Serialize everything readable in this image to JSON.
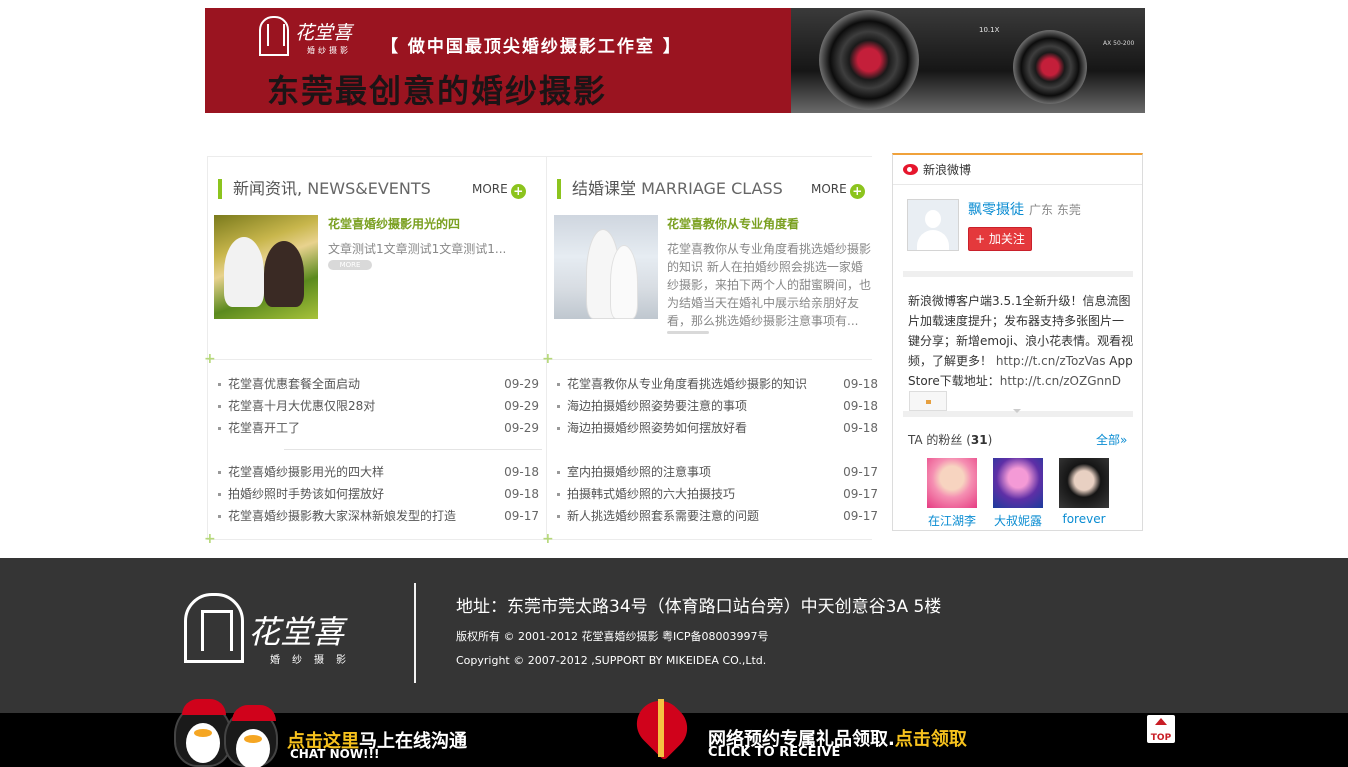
{
  "banner": {
    "logo_text": "花堂喜",
    "logo_sub": "婚纱摄影",
    "slogan": "【 做中国最顶尖婚纱摄影工作室 】",
    "headline": "东莞最创意的婚纱摄影",
    "camera_label": "10.1X",
    "camera_label2": "AX 50-200"
  },
  "news": {
    "title_cn": "新闻资讯",
    "title_en": "NEWS&EVENTS",
    "more": "MORE",
    "featured_title": "花堂喜婚纱摄影用光的四",
    "featured_desc": "文章测试1文章测试1文章测试1...",
    "featured_more": "MORE",
    "items_a": [
      {
        "title": "花堂喜优惠套餐全面启动",
        "date": "09-29"
      },
      {
        "title": "花堂喜十月大优惠仅限28对",
        "date": "09-29"
      },
      {
        "title": "花堂喜开工了",
        "date": "09-29"
      }
    ],
    "items_b": [
      {
        "title": "花堂喜婚纱摄影用光的四大样",
        "date": "09-18"
      },
      {
        "title": "拍婚纱照时手势该如何摆放好",
        "date": "09-18"
      },
      {
        "title": "花堂喜婚纱摄影教大家深林新娘发型的打造",
        "date": "09-17"
      }
    ]
  },
  "classes": {
    "title_cn": "结婚课堂",
    "title_en": "MARRIAGE CLASS",
    "more": "MORE",
    "featured_title": "花堂喜教你从专业角度看",
    "featured_desc": "花堂喜教你从专业角度看挑选婚纱摄影的知识 新人在拍婚纱照会挑选一家婚纱摄影，来拍下两个人的甜蜜瞬间，也为结婚当天在婚礼中展示给亲朋好友看，那么挑选婚纱摄影注意事项有...",
    "items_a": [
      {
        "title": "花堂喜教你从专业角度看挑选婚纱摄影的知识",
        "date": "09-18"
      },
      {
        "title": "海边拍摄婚纱照姿势要注意的事项",
        "date": "09-18"
      },
      {
        "title": "海边拍摄婚纱照姿势如何摆放好看",
        "date": "09-18"
      }
    ],
    "items_b": [
      {
        "title": "室内拍摄婚纱照的注意事项",
        "date": "09-17"
      },
      {
        "title": "拍摄韩式婚纱照的六大拍摄技巧",
        "date": "09-17"
      },
      {
        "title": "新人挑选婚纱照套系需要注意的问题",
        "date": "09-17"
      }
    ]
  },
  "weibo": {
    "header": "新浪微博",
    "name": "飘零摄徒",
    "location": "广东 东莞",
    "follow": "+ 加关注",
    "post": "新浪微博客户端3.5.1全新升级！信息流图片加载速度提升；发布器支持多张图片一键分享；新增emoji、浪小花表情。观看视频，了解更多！",
    "link1": "http://t.cn/zTozVas",
    "post2": " App Store下载地址：",
    "link2": "http://t.cn/zOZGnnD",
    "fans_label": "TA 的粉丝 (",
    "fans_count": "31",
    "fans_close": ")",
    "all": "全部»",
    "fans": [
      "在江湖李",
      "大叔妮露",
      "forever"
    ]
  },
  "footer": {
    "logo_text": "花堂喜",
    "logo_sub": "婚纱摄影",
    "address": "地址：东莞市莞太路34号（体育路口站台旁）中天创意谷3A 5楼",
    "copyright": "版权所有 © 2001-2012 花堂喜婚纱摄影 粤ICP备08003997号",
    "support": "Copyright © 2007-2012 ,SUPPORT BY MIKEIDEA CO.,Ltd."
  },
  "bottombar": {
    "chat_hl": "点击这里",
    "chat_rest": "马上在线沟通",
    "chat_en": "CHAT NOW!!!",
    "gift_text": "网络预约专属礼品领取.",
    "gift_hl": "点击领取",
    "gift_en": "CLICK TO RECEIVE",
    "top": "TOP"
  }
}
